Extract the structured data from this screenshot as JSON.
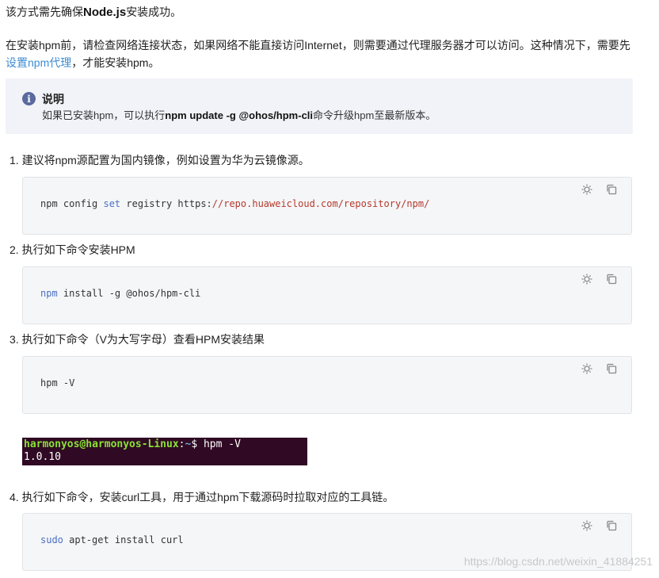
{
  "intro": {
    "line1_pre": "该方式需先确保",
    "line1_bold": "Node.js",
    "line1_post": "安装成功。",
    "para2_pre": "在安装hpm前，请检查网络连接状态，如果网络不能直接访问Internet，则需要通过代理服务器才可以访问。这种情况下，需要先",
    "para2_link": "设置npm代理",
    "para2_post": "，才能安装hpm。"
  },
  "note": {
    "icon": "i",
    "title": "说明",
    "body_pre": "如果已安装hpm，可以执行",
    "body_bold": "npm update -g @ohos/hpm-cli",
    "body_post": "命令升级hpm至最新版本。"
  },
  "steps": [
    {
      "label": "1. 建议将npm源配置为国内镜像，例如设置为华为云镜像源。",
      "code_kw": "npm config ",
      "code_kw2": "set",
      "code_mid": " registry https:",
      "code_str": "//repo.huaweicloud.com/repository/npm/"
    },
    {
      "label": "2. 执行如下命令安装HPM",
      "code_kw": "npm",
      "code_rest": " install -g @ohos/hpm-cli"
    },
    {
      "label": "3. 执行如下命令（V为大写字母）查看HPM安装结果",
      "code": "hpm -V"
    },
    {
      "label": "4. 执行如下命令，安装curl工具，用于通过hpm下载源码时拉取对应的工具链。",
      "code_kw": "sudo",
      "code_rest": " apt-get install curl"
    }
  ],
  "terminal": {
    "user": "harmonyos@harmonyos-Linux",
    "colon": ":",
    "path": "~",
    "prompt": "$ hpm -V",
    "output": "1.0.10"
  },
  "watermark": "https://blog.csdn.net/weixin_41884251",
  "icons": {
    "theme": "sun-icon",
    "copy": "copy-icon"
  },
  "colors": {
    "link": "#3f8cd4",
    "note_bg": "#f1f3f8",
    "terminal_bg": "#300a24",
    "keyword": "#4a6fc1",
    "string": "#b5392b"
  }
}
